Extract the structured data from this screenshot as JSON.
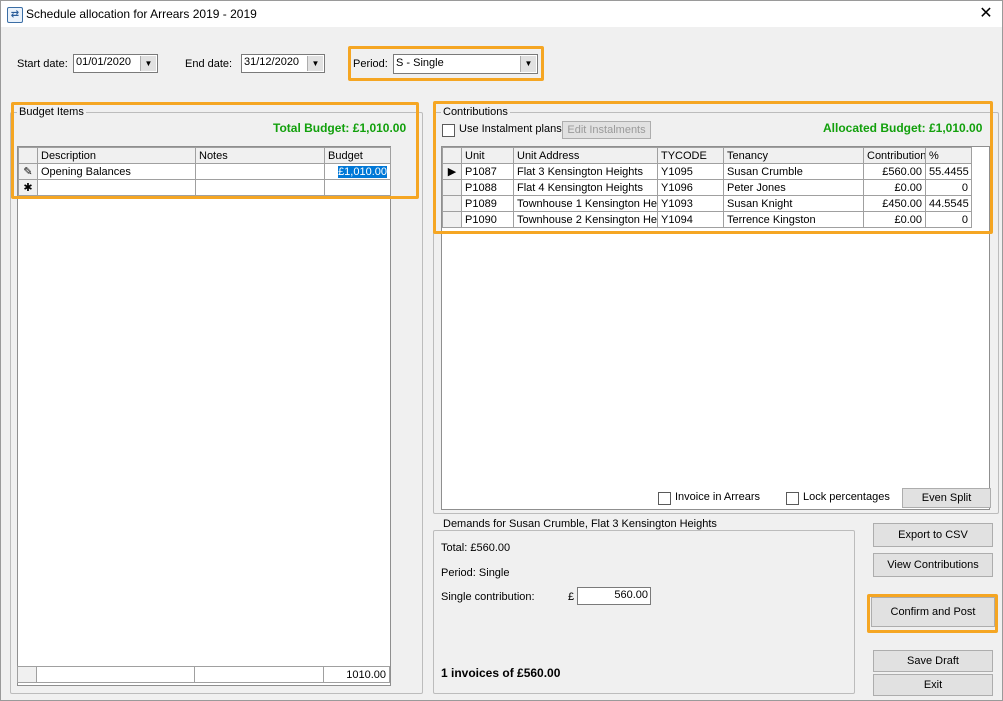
{
  "window": {
    "title": "Schedule allocation for Arrears 2019 - 2019",
    "icon": "app-icon"
  },
  "filters": {
    "start_label": "Start date:",
    "start_value": "01/01/2020",
    "end_label": "End date:",
    "end_value": "31/12/2020",
    "period_label": "Period:",
    "period_value": "S - Single"
  },
  "budget": {
    "group_title": "Budget Items",
    "total_label": "Total Budget: £1,010.00",
    "columns": [
      "Description",
      "Notes",
      "Budget"
    ],
    "rows": [
      {
        "description": "Opening Balances",
        "notes": "",
        "budget": "£1,010.00"
      }
    ],
    "footer_total": "1010.00"
  },
  "contributions": {
    "group_title": "Contributions",
    "use_instalment_label": "Use Instalment plans",
    "edit_instalments_label": "Edit Instalments",
    "allocated_label": "Allocated Budget: £1,010.00",
    "columns": [
      "Unit",
      "Unit Address",
      "TYCODE",
      "Tenancy",
      "Contribution",
      "%"
    ],
    "rows": [
      {
        "unit": "P1087",
        "address": "Flat 3 Kensington Heights",
        "tycode": "Y1095",
        "tenancy": "Susan Crumble",
        "contribution": "£560.00",
        "pct": "55.4455"
      },
      {
        "unit": "P1088",
        "address": "Flat 4 Kensington Heights",
        "tycode": "Y1096",
        "tenancy": "Peter Jones",
        "contribution": "£0.00",
        "pct": "0"
      },
      {
        "unit": "P1089",
        "address": "Townhouse 1 Kensington He",
        "tycode": "Y1093",
        "tenancy": "Susan Knight",
        "contribution": "£450.00",
        "pct": "44.5545"
      },
      {
        "unit": "P1090",
        "address": "Townhouse 2 Kensington He",
        "tycode": "Y1094",
        "tenancy": "Terrence Kingston",
        "contribution": "£0.00",
        "pct": "0"
      }
    ],
    "invoice_in_arrears_label": "Invoice in Arrears",
    "lock_percentages_label": "Lock percentages",
    "even_split_label": "Even Split"
  },
  "demands": {
    "group_title": "Demands for Susan Crumble, Flat 3 Kensington Heights",
    "total": "Total: £560.00",
    "period": "Period: Single",
    "single_label": "Single contribution:",
    "currency": "£",
    "single_value": "560.00",
    "summary": "1 invoices of £560.00"
  },
  "actions": {
    "export_csv": "Export to CSV",
    "view_contributions": "View Contributions",
    "confirm_post": "Confirm and Post",
    "save_draft": "Save Draft",
    "exit": "Exit"
  },
  "colors": {
    "highlight": "#f5a623",
    "total_green": "#12a00c",
    "selection_blue": "#0078d7"
  }
}
